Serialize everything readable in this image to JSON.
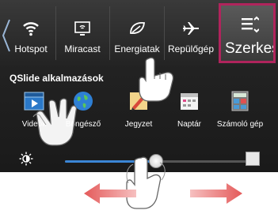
{
  "toggles": [
    {
      "label": "Hotspot",
      "icon": "wifi-hotspot-icon"
    },
    {
      "label": "Miracast",
      "icon": "miracast-icon"
    },
    {
      "label": "Energiatak",
      "icon": "energy-saver-icon"
    },
    {
      "label": "Repülőgép",
      "icon": "airplane-icon"
    }
  ],
  "edit_tile": {
    "label": "Szerkesz",
    "icon": "edit-list-icon"
  },
  "qslide": {
    "title": "QSlide alkalmazások",
    "apps": [
      {
        "label": "Videók",
        "icon": "video-clapper-icon"
      },
      {
        "label": "Böngésző",
        "icon": "globe-icon"
      },
      {
        "label": "Jegyzet",
        "icon": "notepad-icon"
      },
      {
        "label": "Naptár",
        "icon": "calendar-icon"
      },
      {
        "label": "Számoló gép",
        "icon": "calculator-icon"
      }
    ]
  },
  "brightness": {
    "level": 0.5,
    "icon": "brightness-sun-icon",
    "auto_checked": false
  },
  "colors": {
    "accent": "#3b86d6",
    "edit_border": "#b0245c",
    "arrow": "#e06060"
  }
}
